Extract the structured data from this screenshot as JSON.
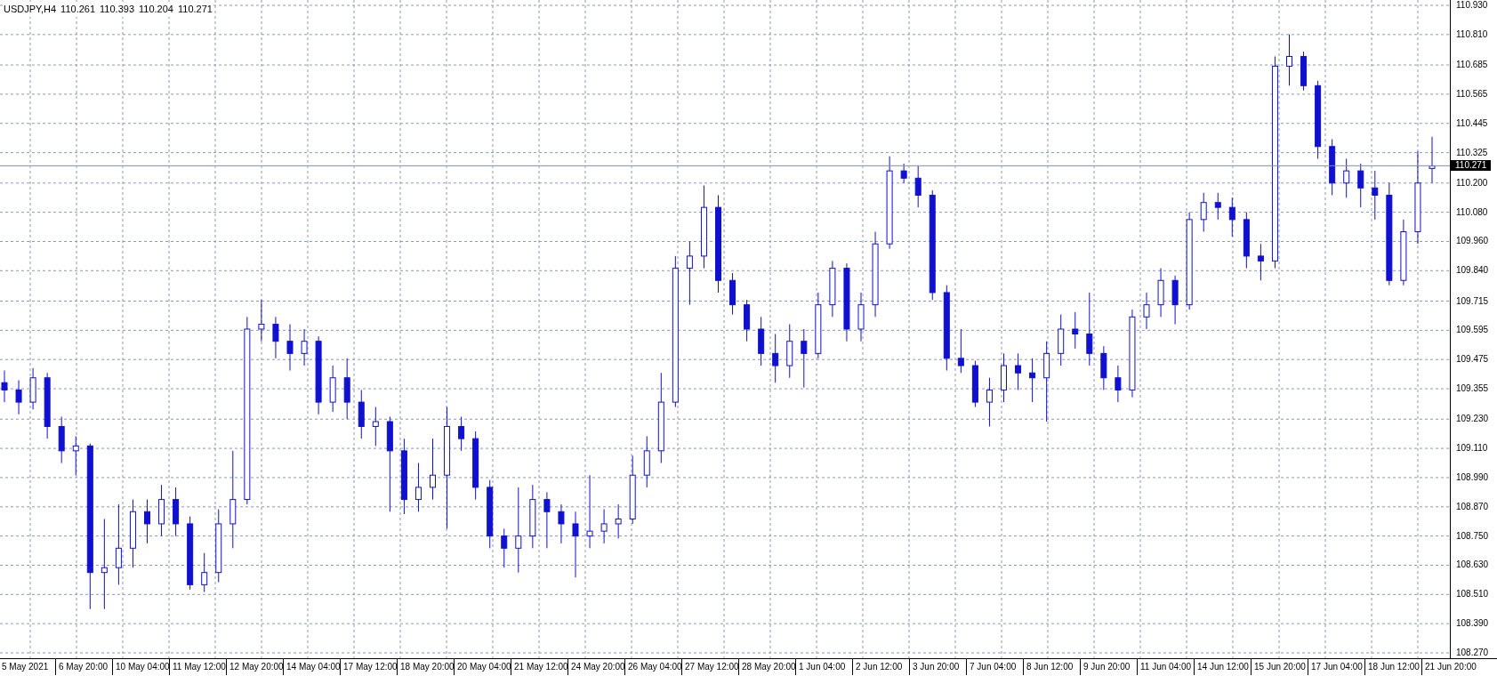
{
  "chart_window": {
    "symbol": "USDJPY,H4",
    "ohlc": [
      "110.261",
      "110.393",
      "110.204",
      "110.271"
    ],
    "current_price": "110.271",
    "time_axis": [
      "5 May 2021",
      "6 May 20:00",
      "10 May 04:00",
      "11 May 12:00",
      "12 May 20:00",
      "14 May 04:00",
      "17 May 12:00",
      "18 May 20:00",
      "20 May 04:00",
      "21 May 12:00",
      "24 May 20:00",
      "26 May 04:00",
      "27 May 12:00",
      "28 May 20:00",
      "1 Jun 04:00",
      "2 Jun 12:00",
      "3 Jun 20:00",
      "7 Jun 04:00",
      "8 Jun 12:00",
      "9 Jun 20:00",
      "11 Jun 04:00",
      "14 Jun 12:00",
      "15 Jun 20:00",
      "17 Jun 04:00",
      "18 Jun 12:00",
      "21 Jun 20:00"
    ],
    "chart_data": {
      "type": "candlestick",
      "ylim": [
        108.27,
        110.93
      ],
      "grid": true,
      "ref_lines": [
        {
          "axis": "y",
          "value": 110.271
        }
      ],
      "categories": [
        null,
        null,
        null,
        null,
        null,
        null,
        null,
        null,
        null,
        null,
        null,
        null,
        null,
        null,
        null,
        null,
        null,
        null,
        null,
        null,
        null,
        null,
        null,
        null,
        null,
        null,
        null,
        null,
        null,
        null,
        null,
        null,
        null,
        null,
        null,
        null,
        null,
        null,
        null,
        null,
        null,
        null,
        null,
        null,
        null,
        null,
        null,
        null,
        null,
        null,
        null,
        null,
        null,
        null,
        null,
        null,
        null,
        null,
        null,
        null,
        null,
        null,
        null,
        null,
        null,
        null,
        null,
        null,
        null,
        null,
        null,
        null,
        null,
        null,
        null,
        null,
        null,
        null,
        null,
        null,
        null,
        null,
        null,
        null,
        null,
        null,
        null,
        null,
        null,
        null,
        null,
        null,
        null,
        null,
        null,
        null,
        null,
        null,
        null,
        null,
        null
      ],
      "yticks": [
        {
          "value": 110.93,
          "label": "110.930"
        },
        {
          "value": 110.81,
          "label": "110.810"
        },
        {
          "value": 110.685,
          "label": "110.685"
        },
        {
          "value": 110.565,
          "label": "110.565"
        },
        {
          "value": 110.445,
          "label": "110.445"
        },
        {
          "value": 110.325,
          "label": "110.325"
        },
        {
          "value": 110.2,
          "label": "110.200"
        },
        {
          "value": 110.08,
          "label": "110.080"
        },
        {
          "value": 109.96,
          "label": "109.960"
        },
        {
          "value": 109.84,
          "label": "109.840"
        },
        {
          "value": 109.715,
          "label": "109.715"
        },
        {
          "value": 109.595,
          "label": "109.595"
        },
        {
          "value": 109.475,
          "label": "109.475"
        },
        {
          "value": 109.355,
          "label": "109.355"
        },
        {
          "value": 109.23,
          "label": "109.230"
        },
        {
          "value": 109.11,
          "label": "109.110"
        },
        {
          "value": 108.99,
          "label": "108.990"
        },
        {
          "value": 108.87,
          "label": "108.870"
        },
        {
          "value": 108.75,
          "label": "108.750"
        },
        {
          "value": 108.63,
          "label": "108.630"
        },
        {
          "value": 108.51,
          "label": "108.510"
        },
        {
          "value": 108.39,
          "label": "108.390"
        },
        {
          "value": 108.27,
          "label": "108.270"
        }
      ],
      "ohlc": [
        [
          109.38,
          109.43,
          109.3,
          109.35
        ],
        [
          109.35,
          109.39,
          109.25,
          109.3
        ],
        [
          109.3,
          109.44,
          109.27,
          109.4
        ],
        [
          109.4,
          109.42,
          109.15,
          109.2
        ],
        [
          109.2,
          109.24,
          109.05,
          109.1
        ],
        [
          109.1,
          109.16,
          109.0,
          109.12
        ],
        [
          109.12,
          109.13,
          108.45,
          108.6
        ],
        [
          108.6,
          108.82,
          108.45,
          108.62
        ],
        [
          108.62,
          108.88,
          108.55,
          108.7
        ],
        [
          108.7,
          108.9,
          108.62,
          108.85
        ],
        [
          108.85,
          108.9,
          108.72,
          108.8
        ],
        [
          108.8,
          108.96,
          108.75,
          108.9
        ],
        [
          108.9,
          108.95,
          108.75,
          108.8
        ],
        [
          108.8,
          108.83,
          108.53,
          108.55
        ],
        [
          108.55,
          108.68,
          108.52,
          108.6
        ],
        [
          108.6,
          108.86,
          108.56,
          108.8
        ],
        [
          108.8,
          109.1,
          108.7,
          108.9
        ],
        [
          108.9,
          109.65,
          108.88,
          109.6
        ],
        [
          109.6,
          109.72,
          109.55,
          109.62
        ],
        [
          109.62,
          109.65,
          109.48,
          109.55
        ],
        [
          109.55,
          109.62,
          109.43,
          109.5
        ],
        [
          109.5,
          109.6,
          109.45,
          109.55
        ],
        [
          109.55,
          109.57,
          109.25,
          109.3
        ],
        [
          109.3,
          109.45,
          109.26,
          109.4
        ],
        [
          109.4,
          109.48,
          109.23,
          109.3
        ],
        [
          109.3,
          109.35,
          109.15,
          109.2
        ],
        [
          109.2,
          109.28,
          109.12,
          109.22
        ],
        [
          109.22,
          109.24,
          108.85,
          109.1
        ],
        [
          109.1,
          109.15,
          108.84,
          108.9
        ],
        [
          108.9,
          109.05,
          108.85,
          108.95
        ],
        [
          108.95,
          109.15,
          108.9,
          109.0
        ],
        [
          109.0,
          109.28,
          108.78,
          109.2
        ],
        [
          109.2,
          109.24,
          109.1,
          109.15
        ],
        [
          109.15,
          109.18,
          108.9,
          108.95
        ],
        [
          108.95,
          108.98,
          108.7,
          108.75
        ],
        [
          108.75,
          108.78,
          108.62,
          108.7
        ],
        [
          108.7,
          108.95,
          108.6,
          108.75
        ],
        [
          108.75,
          108.96,
          108.7,
          108.9
        ],
        [
          108.9,
          108.93,
          108.7,
          108.85
        ],
        [
          108.85,
          108.88,
          108.72,
          108.8
        ],
        [
          108.8,
          108.85,
          108.58,
          108.75
        ],
        [
          108.75,
          109.0,
          108.7,
          108.77
        ],
        [
          108.77,
          108.86,
          108.72,
          108.8
        ],
        [
          108.8,
          108.88,
          108.74,
          108.82
        ],
        [
          108.82,
          109.08,
          108.8,
          109.0
        ],
        [
          109.0,
          109.16,
          108.95,
          109.1
        ],
        [
          109.1,
          109.42,
          109.05,
          109.3
        ],
        [
          109.3,
          109.9,
          109.28,
          109.85
        ],
        [
          109.85,
          109.96,
          109.7,
          109.9
        ],
        [
          109.9,
          110.19,
          109.85,
          110.1
        ],
        [
          110.1,
          110.15,
          109.75,
          109.8
        ],
        [
          109.8,
          109.83,
          109.66,
          109.7
        ],
        [
          109.7,
          109.72,
          109.55,
          109.6
        ],
        [
          109.6,
          109.65,
          109.45,
          109.5
        ],
        [
          109.5,
          109.58,
          109.38,
          109.45
        ],
        [
          109.45,
          109.62,
          109.4,
          109.55
        ],
        [
          109.55,
          109.6,
          109.36,
          109.5
        ],
        [
          109.5,
          109.75,
          109.48,
          109.7
        ],
        [
          109.7,
          109.88,
          109.65,
          109.85
        ],
        [
          109.85,
          109.87,
          109.55,
          109.6
        ],
        [
          109.6,
          109.75,
          109.55,
          109.7
        ],
        [
          109.7,
          110.0,
          109.65,
          109.95
        ],
        [
          109.95,
          110.31,
          109.93,
          110.25
        ],
        [
          110.25,
          110.28,
          110.2,
          110.22
        ],
        [
          110.22,
          110.27,
          110.1,
          110.15
        ],
        [
          110.15,
          110.17,
          109.72,
          109.75
        ],
        [
          109.75,
          109.78,
          109.43,
          109.48
        ],
        [
          109.48,
          109.6,
          109.42,
          109.45
        ],
        [
          109.45,
          109.47,
          109.28,
          109.3
        ],
        [
          109.3,
          109.4,
          109.2,
          109.35
        ],
        [
          109.35,
          109.5,
          109.3,
          109.45
        ],
        [
          109.45,
          109.5,
          109.35,
          109.42
        ],
        [
          109.42,
          109.48,
          109.3,
          109.4
        ],
        [
          109.4,
          109.55,
          109.22,
          109.5
        ],
        [
          109.5,
          109.66,
          109.45,
          109.6
        ],
        [
          109.6,
          109.67,
          109.52,
          109.58
        ],
        [
          109.58,
          109.75,
          109.45,
          109.5
        ],
        [
          109.5,
          109.53,
          109.35,
          109.4
        ],
        [
          109.4,
          109.45,
          109.3,
          109.35
        ],
        [
          109.35,
          109.68,
          109.32,
          109.65
        ],
        [
          109.65,
          109.75,
          109.6,
          109.7
        ],
        [
          109.7,
          109.85,
          109.65,
          109.8
        ],
        [
          109.8,
          109.82,
          109.62,
          109.7
        ],
        [
          109.7,
          110.08,
          109.68,
          110.05
        ],
        [
          110.05,
          110.16,
          110.0,
          110.12
        ],
        [
          110.12,
          110.16,
          110.05,
          110.1
        ],
        [
          110.1,
          110.14,
          109.98,
          110.05
        ],
        [
          110.05,
          110.08,
          109.85,
          109.9
        ],
        [
          109.9,
          109.95,
          109.8,
          109.88
        ],
        [
          109.88,
          110.72,
          109.85,
          110.68
        ],
        [
          110.68,
          110.81,
          110.6,
          110.72
        ],
        [
          110.72,
          110.74,
          110.58,
          110.6
        ],
        [
          110.6,
          110.62,
          110.3,
          110.35
        ],
        [
          110.35,
          110.38,
          110.15,
          110.2
        ],
        [
          110.2,
          110.3,
          110.14,
          110.25
        ],
        [
          110.25,
          110.28,
          110.1,
          110.18
        ],
        [
          110.18,
          110.25,
          110.05,
          110.15
        ],
        [
          110.15,
          110.2,
          109.78,
          109.8
        ],
        [
          109.8,
          110.05,
          109.78,
          110.0
        ],
        [
          110.0,
          110.33,
          109.95,
          110.2
        ],
        [
          110.26,
          110.39,
          110.2,
          110.27
        ]
      ]
    }
  }
}
